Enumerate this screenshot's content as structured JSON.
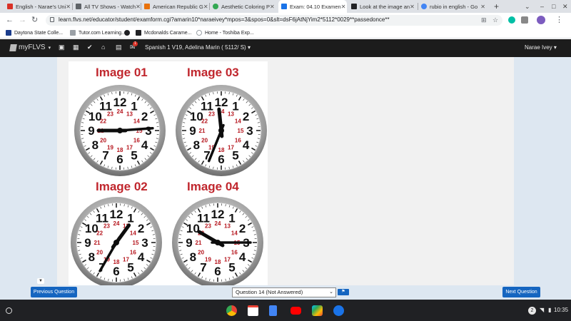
{
  "browser": {
    "tabs": [
      {
        "title": "English - Narae's Uni",
        "favicon_color": "#d93025"
      },
      {
        "title": "All TV Shows - Watch",
        "favicon_color": "#5f6368"
      },
      {
        "title": "American Republic G",
        "favicon_color": "#e8710a"
      },
      {
        "title": "Aesthetic Coloring P",
        "favicon_color": "#34a853"
      },
      {
        "title": "Exam: 04.10 Examen",
        "favicon_color": "#1a73e8",
        "active": true
      },
      {
        "title": "Look at the image an",
        "favicon_color": "#202124"
      },
      {
        "title": "rubio in english - Go",
        "favicon_color": "#4285f4"
      }
    ],
    "url": "learn.flvs.net/educator/student/examform.cgi?amarin10*naraeivey*mpos=3&spos=0&slt=dsF6jAtNjYim2*5112*0029**passedonce**",
    "bookmarks": [
      {
        "label": "Daytona State Colle...",
        "color": "#1a3c8c"
      },
      {
        "label": "Tutor.com Learning...",
        "color": "#9aa0a6"
      },
      {
        "label": "",
        "color": "#202124"
      },
      {
        "label": "Mcdonalds Carame...",
        "color": "#202124"
      },
      {
        "label": "Home - Toshiba Exp...",
        "color": "#9aa0a6"
      }
    ]
  },
  "flvs": {
    "logo_text": "myFLVS",
    "notification_count": "1",
    "course": "Spanish 1 V19, Adelina Marin ( 5112/ S)",
    "user": "Narae Ivey"
  },
  "images": [
    {
      "label": "Image 01",
      "hour_deg": 270,
      "minute_deg": 86
    },
    {
      "label": "Image 03",
      "hour_deg": 354,
      "minute_deg": 202
    },
    {
      "label": "Image 02",
      "hour_deg": 36,
      "minute_deg": 210
    },
    {
      "label": "Image 04",
      "hour_deg": 300,
      "minute_deg": 90
    }
  ],
  "footer": {
    "prev_label": "Previous Question",
    "question_select": "Question 14 (Not Answered)",
    "next_label": "Next Question"
  },
  "shelf": {
    "apps": [
      "Chrome",
      "Gmail",
      "Docs",
      "YouTube",
      "Play Store",
      "Duo"
    ],
    "notification_count": "2",
    "time": "10:35"
  }
}
